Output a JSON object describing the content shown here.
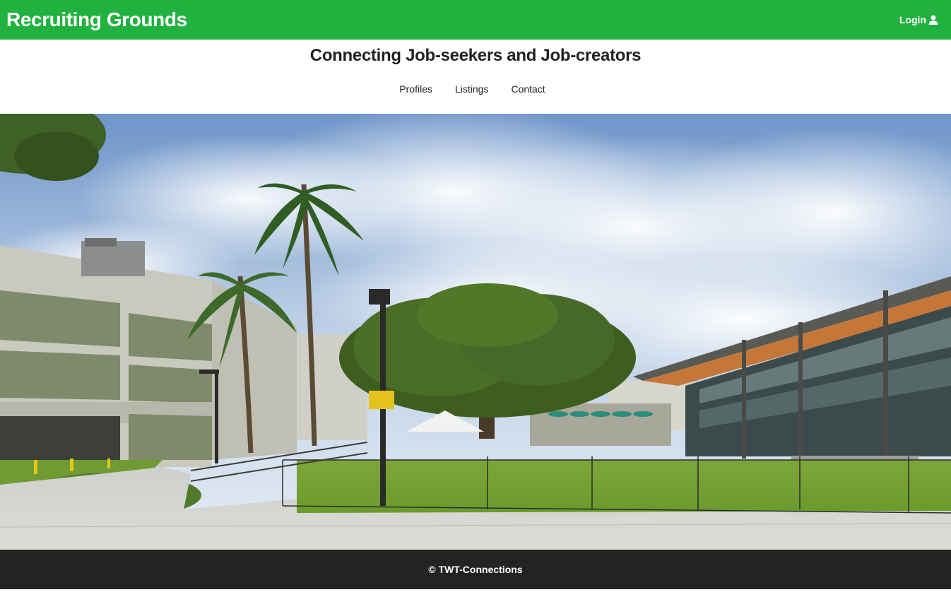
{
  "header": {
    "brand": "Recruiting Grounds",
    "login_label": "Login",
    "login_icon": "user-icon",
    "background_color": "#21b13f"
  },
  "subheader": {
    "tagline": "Connecting Job-seekers and Job-creators"
  },
  "nav": {
    "items": [
      {
        "label": "Profiles"
      },
      {
        "label": "Listings"
      },
      {
        "label": "Contact"
      }
    ]
  },
  "hero": {
    "image": "campus-photo"
  },
  "footer": {
    "copyright": "© TWT-Connections",
    "background_color": "#232323"
  }
}
